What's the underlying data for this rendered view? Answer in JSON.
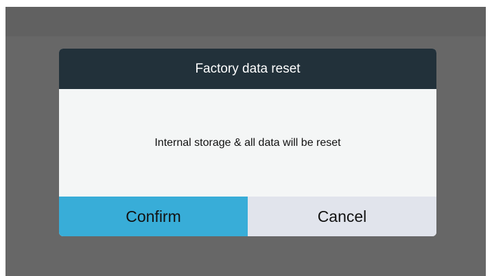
{
  "dialog": {
    "title": "Factory data reset",
    "message": "Internal storage & all data will be reset",
    "confirm_label": "Confirm",
    "cancel_label": "Cancel"
  },
  "colors": {
    "screen_background": "#676767",
    "header_background": "#22313a",
    "body_background": "#f4f6f6",
    "confirm_background": "#38add8",
    "cancel_background": "#e1e4ec"
  }
}
